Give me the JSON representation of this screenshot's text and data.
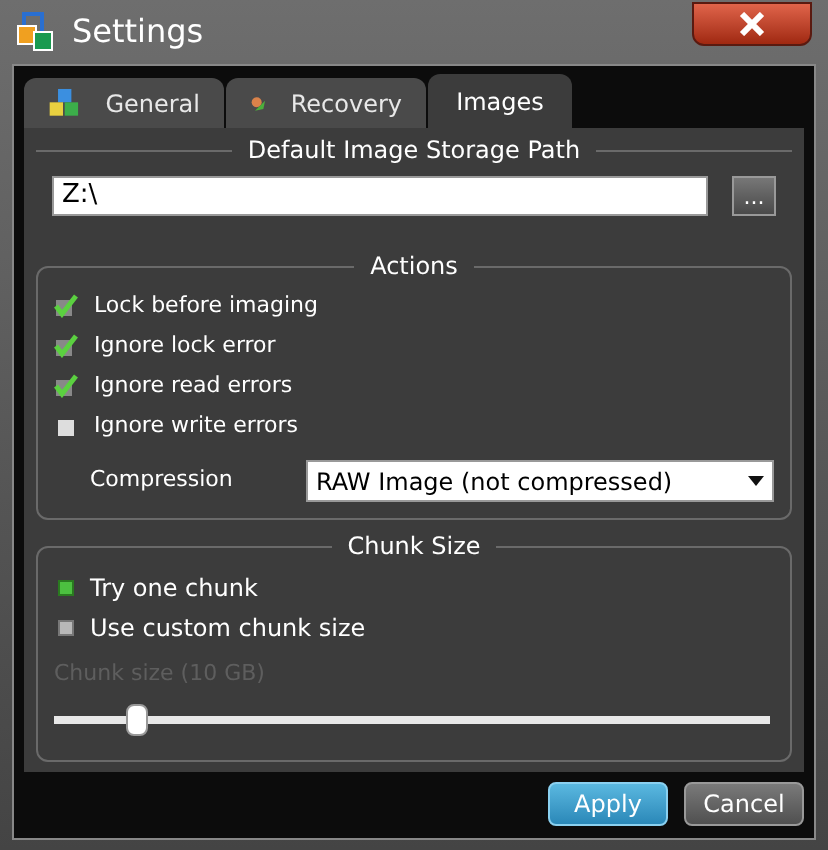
{
  "window": {
    "title": "Settings"
  },
  "tabs": [
    {
      "label": "General",
      "selected": false
    },
    {
      "label": "Recovery",
      "selected": false
    },
    {
      "label": "Images",
      "selected": true
    }
  ],
  "storage_path": {
    "title": "Default Image Storage Path",
    "value": "Z:\\",
    "browse": "..."
  },
  "actions": {
    "title": "Actions",
    "options": [
      {
        "label": "Lock before imaging",
        "checked": true
      },
      {
        "label": "Ignore lock error",
        "checked": true
      },
      {
        "label": "Ignore read errors",
        "checked": true
      },
      {
        "label": "Ignore write errors",
        "checked": false
      }
    ],
    "compression": {
      "label": "Compression",
      "value": "RAW Image (not compressed)"
    }
  },
  "chunk_size": {
    "title": "Chunk Size",
    "options": [
      {
        "label": "Try one chunk",
        "selected": true
      },
      {
        "label": "Use custom chunk size",
        "selected": false
      }
    ],
    "slider": {
      "label": "Chunk size (10 GB)",
      "disabled": true,
      "level": 0.1
    }
  },
  "buttons": [
    {
      "label": "Apply",
      "kind": "primary"
    },
    {
      "label": "Cancel",
      "kind": "secondary"
    }
  ]
}
